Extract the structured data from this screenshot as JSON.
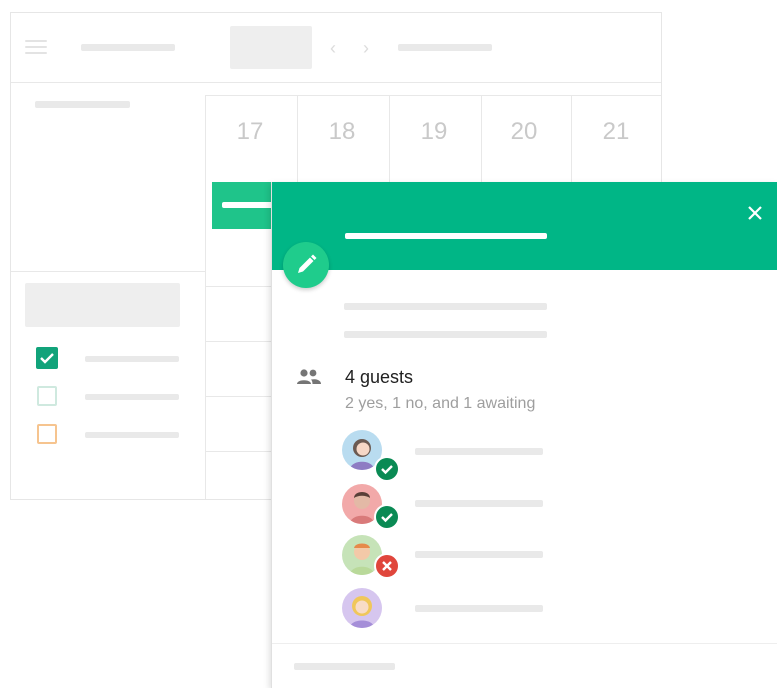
{
  "calendar": {
    "day_numbers": [
      "17",
      "18",
      "19",
      "20",
      "21"
    ]
  },
  "event": {
    "guests": {
      "count_label": "4 guests",
      "summary": "2 yes, 1 no, and 1 awaiting",
      "list": [
        {
          "avatar": "avatar-1",
          "status": "yes",
          "status_icon": "check-icon"
        },
        {
          "avatar": "avatar-2",
          "status": "yes",
          "status_icon": "check-icon"
        },
        {
          "avatar": "avatar-3",
          "status": "no",
          "status_icon": "close-icon"
        },
        {
          "avatar": "avatar-4",
          "status": "awaiting"
        }
      ]
    },
    "icons": {
      "close": "close-icon",
      "edit": "pencil-icon",
      "guests": "people-icon"
    }
  },
  "colors": {
    "header": "#00b686",
    "fab": "#1fcc8c",
    "accepted": "#0a8a54",
    "declined": "#e0463c",
    "checkbox_teal": "#11a37a",
    "checkbox_orange": "#f6c48f"
  }
}
